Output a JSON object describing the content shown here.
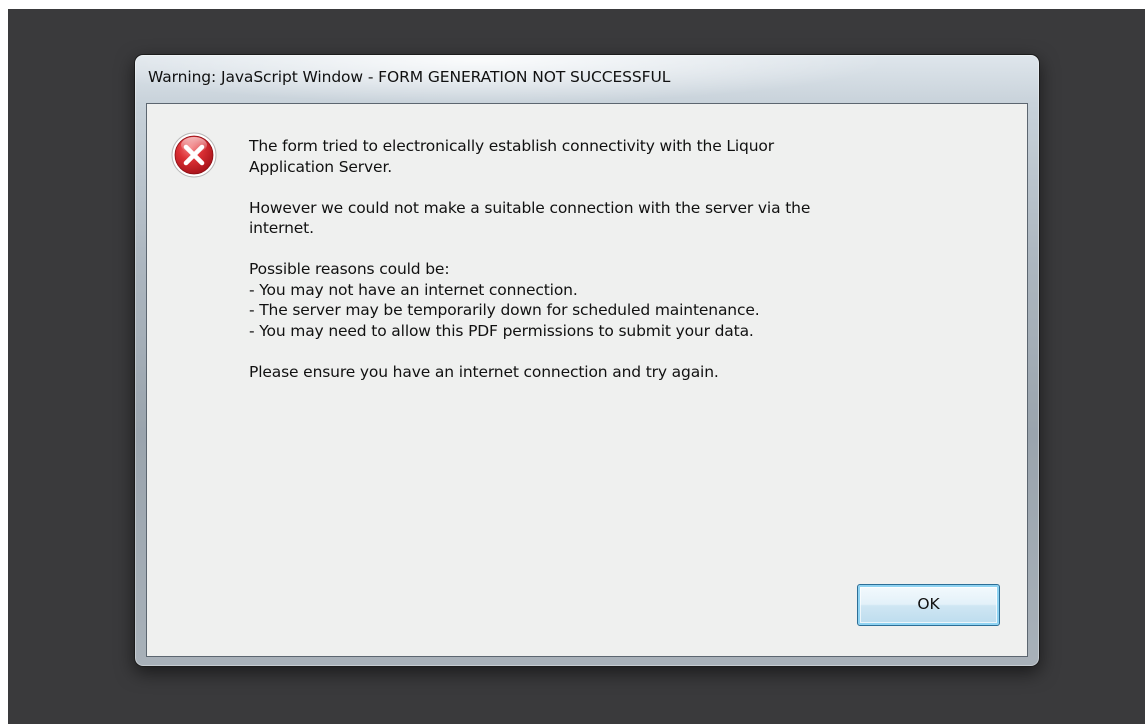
{
  "dialog": {
    "title": "Warning: JavaScript Window - FORM GENERATION NOT SUCCESSFUL",
    "icon": "error-icon",
    "message": {
      "line1": "The form tried to electronically establish connectivity with the Liquor",
      "line2": "Application Server.",
      "line3": "However we could not make a suitable connection with the server via the",
      "line4": "internet.",
      "reasons_heading": "Possible reasons could be:",
      "reasons": [
        "- You may not have an internet connection.",
        "- The server may be temporarily down for scheduled maintenance.",
        "- You may need to allow this PDF permissions to submit your data."
      ],
      "closing": "Please ensure you have an internet connection and try again."
    },
    "ok_label": "OK"
  },
  "colors": {
    "backdrop": "#3a3a3c",
    "client_background": "#eff0ef",
    "error_red": "#d0262a",
    "button_focus": "#8fd3f2"
  }
}
